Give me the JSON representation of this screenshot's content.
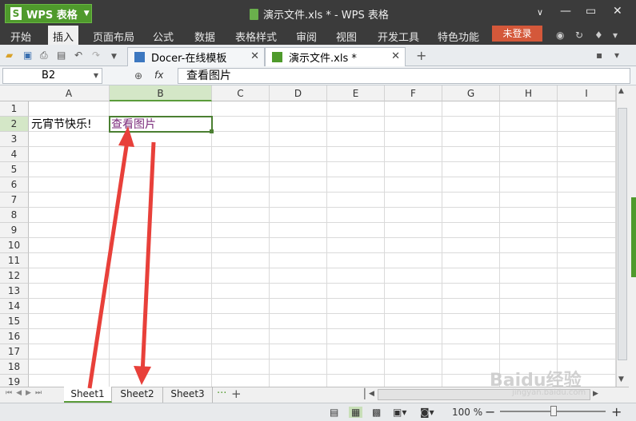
{
  "app": {
    "name": "WPS 表格",
    "window_title": "演示文件.xls * - WPS 表格"
  },
  "menu": [
    "开始",
    "插入",
    "页面布局",
    "公式",
    "数据",
    "表格样式",
    "审阅",
    "视图",
    "开发工具",
    "特色功能"
  ],
  "menu_active": "插入",
  "login_label": "未登录",
  "help_label": "?",
  "tabs": [
    {
      "label": "Docer-在线模板",
      "active": false
    },
    {
      "label": "演示文件.xls *",
      "active": true
    }
  ],
  "formula_bar": {
    "name_box": "B2",
    "fx_label": "fx",
    "content": "查看图片"
  },
  "columns": [
    "A",
    "B",
    "C",
    "D",
    "E",
    "F",
    "G",
    "H",
    "I"
  ],
  "selected_column": "B",
  "rows": [
    "1",
    "2",
    "3",
    "4",
    "5",
    "6",
    "7",
    "8",
    "9",
    "10",
    "11",
    "12",
    "13",
    "14",
    "15",
    "16",
    "17",
    "18",
    "19"
  ],
  "selected_row": "2",
  "cells": {
    "A2": "元宵节快乐!",
    "B2": "查看图片"
  },
  "sheets": [
    "Sheet1",
    "Sheet2",
    "Sheet3"
  ],
  "active_sheet": "Sheet1",
  "sheet_more": "···",
  "sheet_add": "+",
  "zoom": "100 %",
  "watermark": {
    "text": "Baidu经验",
    "url": "jingyan.baidu.com"
  },
  "colors": {
    "accent": "#4f9a2c",
    "arrow": "#e8403a",
    "login": "#d4583a",
    "link_text": "#7b2b7b"
  }
}
